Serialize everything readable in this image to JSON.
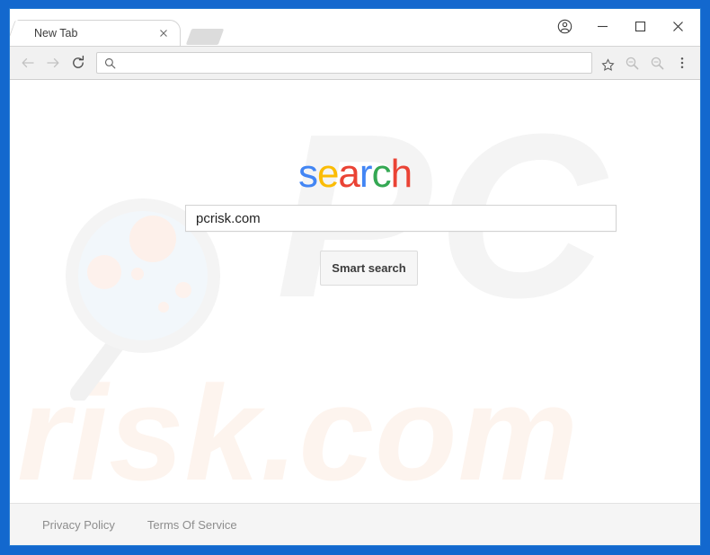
{
  "browser": {
    "tab": {
      "title": "New Tab",
      "close_icon": "close-icon"
    },
    "new_tab_button_icon": "new-tab-icon",
    "window_controls": {
      "profile_icon": "profile-avatar-icon",
      "minimize_icon": "minimize-icon",
      "maximize_icon": "maximize-icon",
      "close_icon": "close-window-icon"
    },
    "toolbar": {
      "back_icon": "back-arrow-icon",
      "forward_icon": "forward-arrow-icon",
      "reload_icon": "reload-icon",
      "omnibox": {
        "search_icon": "search-icon",
        "value": "",
        "placeholder": ""
      },
      "bookmark_icon": "star-icon",
      "extension_one_icon": "magnifier-extension-icon",
      "extension_two_icon": "magnifier-extension-icon",
      "menu_icon": "three-dot-menu-icon"
    }
  },
  "page": {
    "logo": {
      "letters": [
        {
          "char": "s",
          "color": "#4285f4"
        },
        {
          "char": "e",
          "color": "#fbbc05"
        },
        {
          "char": "a",
          "color": "#ea4335"
        },
        {
          "char": "r",
          "color": "#4285f4"
        },
        {
          "char": "c",
          "color": "#34a853"
        },
        {
          "char": "h",
          "color": "#ea4335"
        }
      ],
      "text": "search"
    },
    "search_box": {
      "value": "pcrisk.com",
      "placeholder": ""
    },
    "submit_button": {
      "label": "Smart search"
    },
    "watermarks": {
      "pc": "PC",
      "risk": "risk.com",
      "magnifier_icon": "magnifier-watermark-icon"
    },
    "footer": {
      "links": [
        {
          "label": "Privacy Policy"
        },
        {
          "label": "Terms Of Service"
        }
      ]
    }
  },
  "colors": {
    "frame_blue": "#1368ce",
    "logo_blue": "#4285f4",
    "logo_yellow": "#fbbc05",
    "logo_red": "#ea4335",
    "logo_green": "#34a853"
  }
}
